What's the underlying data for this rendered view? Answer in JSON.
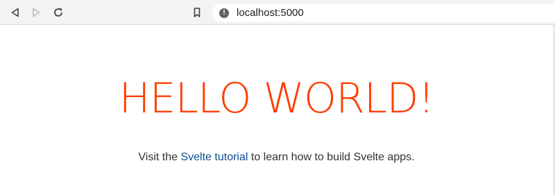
{
  "browser": {
    "url": "localhost:5000",
    "icons": {
      "back": "back-icon",
      "forward": "forward-icon",
      "reload": "reload-icon",
      "bookmark": "bookmark-icon",
      "site_info": "info-icon"
    }
  },
  "page": {
    "heading": "HELLO WORLD!",
    "intro_before": "Visit the ",
    "link_text": "Svelte tutorial",
    "intro_after": " to learn how to build Svelte apps."
  },
  "colors": {
    "heading": "#ff3e00",
    "link": "#0a4b8c",
    "text": "#333333",
    "toolbar": "#f1f3f4"
  }
}
